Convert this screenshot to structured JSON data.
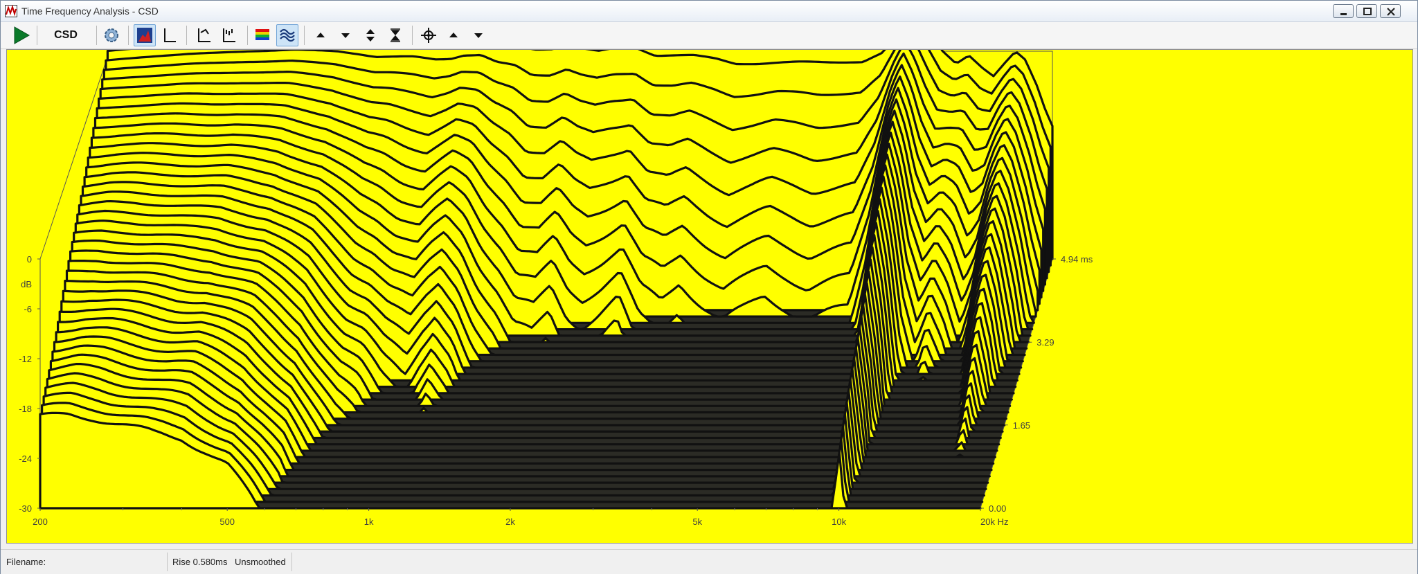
{
  "window": {
    "title": "Time Frequency Analysis - CSD"
  },
  "toolbar": {
    "csd_label": "CSD",
    "icons": [
      "play-icon",
      "gear-icon",
      "waterfall-view-icon",
      "axes-icon",
      "log-y-icon",
      "lin-y-icon",
      "color-palette-icon",
      "waterfall-surface-icon",
      "arrow-up-icon",
      "arrow-down-icon",
      "arrow-updown-icon",
      "arrow-collapse-icon",
      "crosshair-icon",
      "arrow-up-icon",
      "arrow-down-icon"
    ]
  },
  "colors": {
    "plot_background": "#ffff00",
    "trace": "#111111",
    "floor": "#2b2b25",
    "axis_text": "#404040"
  },
  "status": {
    "filename_label": "Filename:",
    "filename_value": "",
    "rise_label": "Rise 0.580ms",
    "smoothing": "Unsmoothed"
  },
  "chart_data": {
    "type": "waterfall",
    "title": "",
    "x_axis": {
      "scale": "log",
      "range": [
        200,
        20000
      ],
      "tick_values": [
        200,
        500,
        1000,
        2000,
        5000,
        10000,
        20000
      ],
      "tick_labels": [
        "200",
        "500",
        "1k",
        "2k",
        "5k",
        "10k",
        "20k Hz"
      ]
    },
    "y_axis": {
      "label": "dB",
      "range": [
        -30,
        0
      ],
      "tick_values": [
        0,
        -6,
        -12,
        -18,
        -24,
        -30
      ],
      "tick_labels": [
        "0",
        "-6",
        "-12",
        "-18",
        "-24",
        "-30"
      ]
    },
    "z_axis": {
      "unit": "ms",
      "range": [
        0,
        4.94
      ],
      "tick_values": [
        0.0,
        1.65,
        3.29,
        4.94
      ],
      "tick_labels": [
        "0.00",
        "1.65",
        "3.29",
        "4.94 ms"
      ]
    },
    "slice_count": 40,
    "anchor_frequencies_hz": [
      200,
      230,
      260,
      300,
      350,
      400,
      450,
      500,
      560,
      620,
      680,
      750,
      820,
      900,
      1000,
      1080,
      1150,
      1250,
      1350,
      1480,
      1600,
      1750,
      1900,
      2050,
      2200,
      2400,
      2650,
      2900,
      3200,
      3500,
      3900,
      4300,
      4800,
      5300,
      5900,
      6500,
      7200,
      8000,
      8800,
      9500,
      10000,
      10500,
      11000,
      11700,
      12500,
      13300,
      14200,
      15000,
      15800,
      16700,
      17500,
      18500,
      19300,
      20000
    ],
    "initial_response_db": [
      -3.8,
      -3.5,
      -3.2,
      -2.9,
      -2.7,
      -2.5,
      -2.3,
      -2.1,
      -2.0,
      -1.9,
      -1.9,
      -2.0,
      -1.8,
      -1.4,
      -1.5,
      -1.8,
      -1.6,
      -1.2,
      -1.5,
      -1.3,
      -1.8,
      -1.6,
      -1.3,
      -1.5,
      -1.7,
      -1.4,
      -1.6,
      -2.0,
      -1.8,
      -2.1,
      -2.2,
      -2.6,
      -2.8,
      -2.9,
      -2.6,
      -2.4,
      -2.5,
      -2.6,
      -2.5,
      -1.2,
      0.3,
      -1.0,
      -2.5,
      -5.0,
      -6.5,
      -5.5,
      -7.0,
      -8.0,
      -6.5,
      -5.0,
      -6.0,
      -9.0,
      -12.0,
      -14.0
    ],
    "decay_rate_factors": [
      0.4,
      0.4,
      0.42,
      0.45,
      0.48,
      0.5,
      0.55,
      0.6,
      0.7,
      0.8,
      0.95,
      1.1,
      1.2,
      1.4,
      1.5,
      1.3,
      1.2,
      1.4,
      1.7,
      2.0,
      2.3,
      2.4,
      2.2,
      2.5,
      2.6,
      2.5,
      2.3,
      2.8,
      3.0,
      2.7,
      3.0,
      3.2,
      3.0,
      2.8,
      3.0,
      3.2,
      3.1,
      3.0,
      2.0,
      0.9,
      0.6,
      0.9,
      1.4,
      1.6,
      1.2,
      1.5,
      1.8,
      1.4,
      1.0,
      0.8,
      1.0,
      1.3,
      1.6,
      1.8
    ]
  }
}
